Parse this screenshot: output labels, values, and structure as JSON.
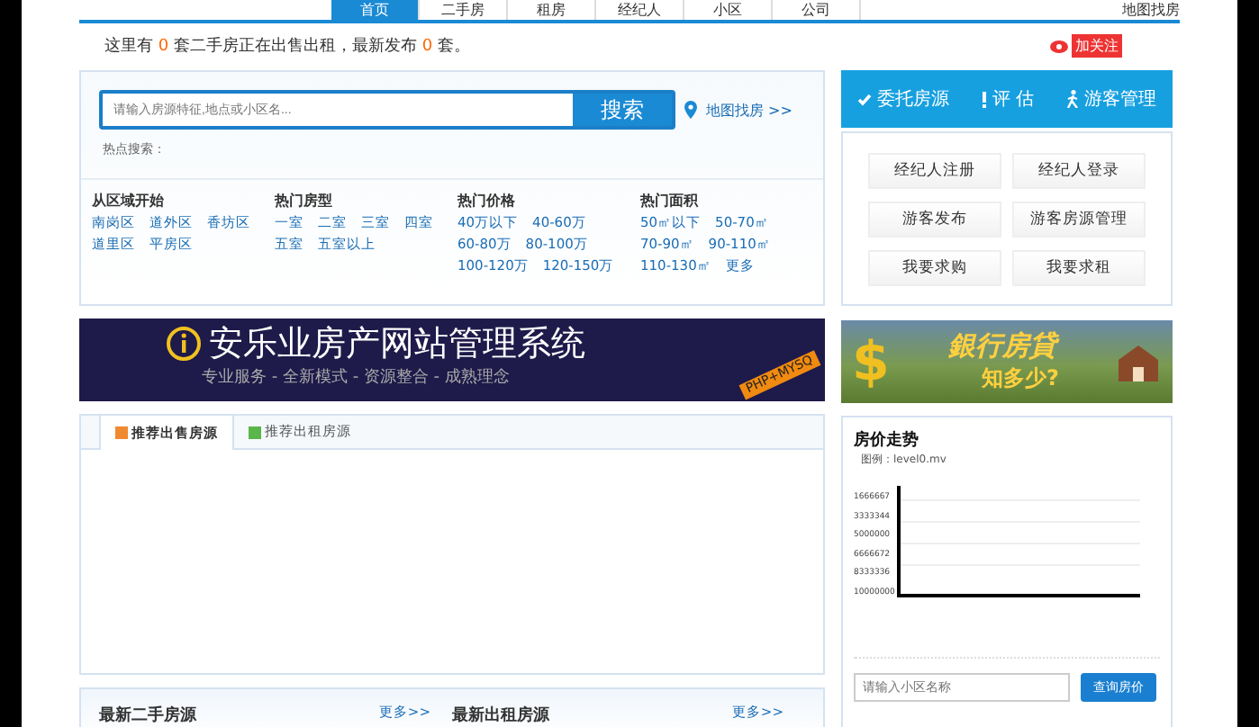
{
  "nav": {
    "items": [
      {
        "label": "首页",
        "selected": true
      },
      {
        "label": "二手房",
        "selected": false
      },
      {
        "label": "租房",
        "selected": false
      },
      {
        "label": "经纪人",
        "selected": false
      },
      {
        "label": "小区",
        "selected": false
      },
      {
        "label": "公司",
        "selected": false
      }
    ],
    "map_link": "地图找房"
  },
  "info": {
    "before": "这里有",
    "count1": "0",
    "middle": "套二手房正在出售出租，最新发布",
    "count2": "0",
    "after": "套。",
    "follow": "加关注"
  },
  "search": {
    "placeholder": "请输入房源特征,地点或小区名...",
    "button": "搜索",
    "map_link": "地图找房 >>",
    "hot_label": "热点搜索："
  },
  "filters": [
    {
      "title": "从区域开始",
      "links": [
        "南岗区",
        "道外区",
        "香坊区",
        "道里区",
        "平房区"
      ]
    },
    {
      "title": "热门房型",
      "links": [
        "一室",
        "二室",
        "三室",
        "四室",
        "五室",
        "五室以上"
      ]
    },
    {
      "title": "热门价格",
      "links": [
        "40万以下",
        "40-60万",
        "60-80万",
        "80-100万",
        "100-120万",
        "120-150万"
      ]
    },
    {
      "title": "热门面积",
      "links": [
        "50㎡以下",
        "50-70㎡",
        "70-90㎡",
        "90-110㎡",
        "110-130㎡",
        "更多"
      ]
    }
  ],
  "side_tabs": [
    {
      "label": "委托房源",
      "kind": "check"
    },
    {
      "label": "评 估",
      "kind": "exclaim"
    },
    {
      "label": "游客管理",
      "kind": "walker"
    }
  ],
  "side_buttons": [
    "经纪人注册",
    "经纪人登录",
    "游客发布",
    "游客房源管理",
    "我要求购",
    "我要求租"
  ],
  "banner": {
    "title": "安乐业房产网站管理系统",
    "subtitle": "专业服务 - 全新模式 - 资源整合 - 成熟理念",
    "ribbon": "PHP+MYSQ"
  },
  "ad": {
    "symbol": "$",
    "line1": "銀行房貸",
    "line2": "知多少?"
  },
  "listing_tabs": [
    {
      "label": "推荐出售房源",
      "selected": true
    },
    {
      "label": "推荐出租房源",
      "selected": false
    }
  ],
  "price_trend": {
    "title": "房价走势",
    "legend": "图例：level0.mv",
    "axis_labels": [
      "1666667",
      "3333344",
      "5000000",
      "6666672",
      "8333336",
      "10000000"
    ],
    "placeholder": "请输入小区名称",
    "button": "查询房价"
  },
  "latest": [
    {
      "title": "最新二手房源",
      "more": "更多>>"
    },
    {
      "title": "最新出租房源",
      "more": "更多>>"
    }
  ]
}
